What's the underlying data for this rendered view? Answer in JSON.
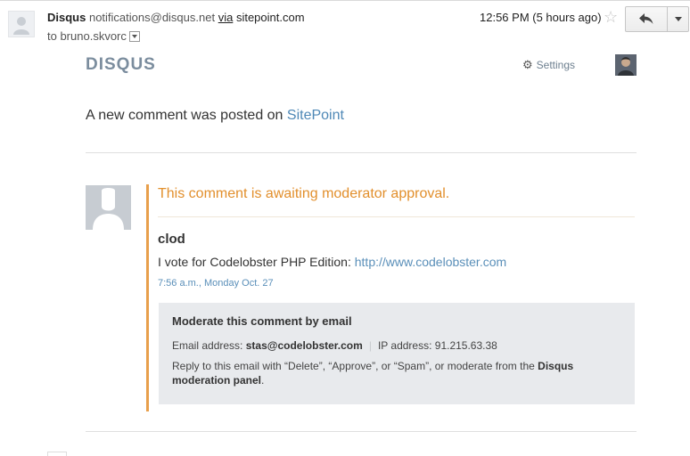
{
  "email": {
    "sender_name": "Disqus",
    "sender_address": "notifications@disqus.net",
    "via_label": "via",
    "via_domain": "sitepoint.com",
    "to_line": "to bruno.skvorc",
    "time": "12:56 PM (5 hours ago)"
  },
  "icons": {
    "star": "☆",
    "gear": "⚙"
  },
  "disqus": {
    "logo": "DISQUS",
    "settings_label": "Settings"
  },
  "notice": {
    "prefix": "A new comment was posted on",
    "site_link": "SitePoint"
  },
  "comment": {
    "status": "This comment is awaiting moderator approval.",
    "author": "clod",
    "text": "I vote for Codelobster PHP Edition:",
    "link": "http://www.codelobster.com",
    "timestamp": "7:56 a.m., Monday Oct. 27"
  },
  "moderation": {
    "title": "Moderate this comment by email",
    "email_label": "Email address:",
    "email_value": "stas@codelobster.com",
    "separator": "|",
    "ip_label": "IP address:",
    "ip_value": "91.215.63.38",
    "reply_text": "Reply to this email with “Delete”, “Approve”, or “Spam”, or moderate from the",
    "panel_link": "Disqus moderation panel",
    "period": "."
  },
  "colors": {
    "accent_orange": "#e28f2c",
    "link_blue": "#4f88b6",
    "logo_gray": "#7b8d9e",
    "mod_box_bg": "#e8eaed"
  }
}
